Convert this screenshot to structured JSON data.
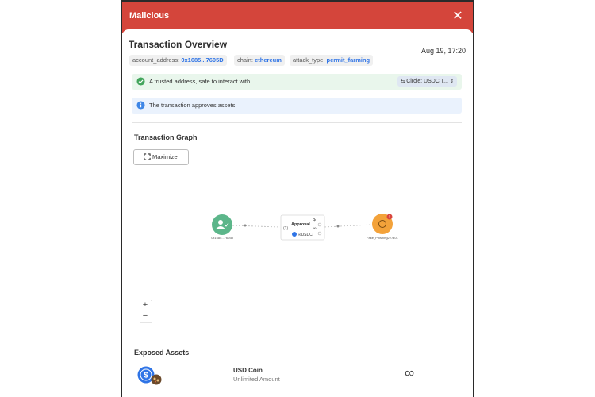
{
  "modal": {
    "title": "Malicious",
    "close_icon": "close-icon"
  },
  "overview": {
    "title": "Transaction Overview",
    "timestamp": "Aug 19, 17:20",
    "chips": [
      {
        "key": "account_address:",
        "value": "0x1685...7605D"
      },
      {
        "key": "chain:",
        "value": "ethereum"
      },
      {
        "key": "attack_type:",
        "value": "permit_farming"
      }
    ]
  },
  "alerts": {
    "success_text": "A trusted address, safe to interact with.",
    "token_select": "Circle: USDC T...",
    "info_text": "The transaction approves assets."
  },
  "graph": {
    "title": "Transaction Graph",
    "maximize_label": "Maximize",
    "nodes": {
      "source_label": "0x1685...7605d",
      "approval_title": "Approval",
      "approval_index": "(1)",
      "approval_symbol": "$",
      "approval_amount": "∞",
      "approval_token": "∞USDC",
      "target_label": "Fake_Phishing227401",
      "target_badge": "!"
    },
    "zoom_in": "+",
    "zoom_out": "−",
    "colors": {
      "source_node": "#5cb68a",
      "target_node": "#f3a23a",
      "badge": "#d9453d"
    }
  },
  "exposed": {
    "title": "Exposed Assets",
    "assets": [
      {
        "name": "USD Coin",
        "amount": "Unlimited Amount",
        "approval": "∞"
      }
    ]
  }
}
